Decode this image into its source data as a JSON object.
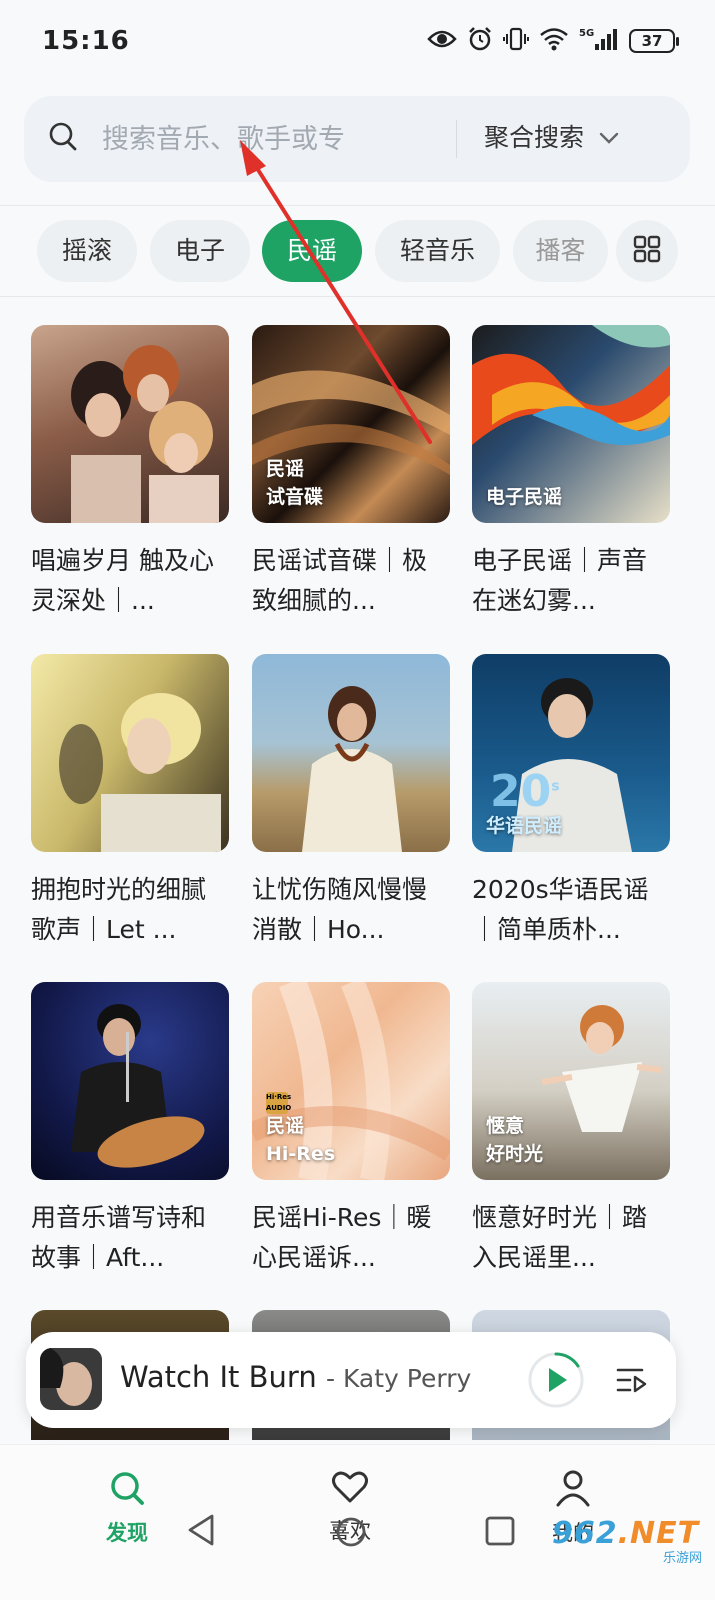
{
  "status_bar": {
    "time": "15:16",
    "battery": "37",
    "network": "5G"
  },
  "search": {
    "placeholder": "搜索音乐、歌手或专",
    "mode_label": "聚合搜索"
  },
  "tabs": [
    {
      "label": "摇滚",
      "active": false
    },
    {
      "label": "电子",
      "active": false
    },
    {
      "label": "民谣",
      "active": true
    },
    {
      "label": "轻音乐",
      "active": false
    },
    {
      "label": "播客",
      "active": false
    }
  ],
  "playlists": [
    {
      "title": "唱遍岁月 触及心灵深处｜...",
      "cover_label": []
    },
    {
      "title": "民谣试音碟｜极致细腻的...",
      "cover_label": [
        "民谣",
        "试音碟"
      ]
    },
    {
      "title": "电子民谣｜声音在迷幻雾...",
      "cover_label": [
        "电子民谣"
      ]
    },
    {
      "title": "拥抱时光的细腻歌声｜Let ...",
      "cover_label": []
    },
    {
      "title": "让忧伤随风慢慢消散｜Ho...",
      "cover_label": []
    },
    {
      "title": "2020s华语民谣｜简单质朴...",
      "cover_label": [
        "华语民谣"
      ],
      "cover_big": "20",
      "cover_small": "s"
    },
    {
      "title": "用音乐谱写诗和故事｜Aft...",
      "cover_label": []
    },
    {
      "title": "民谣Hi-Res｜暖心民谣诉...",
      "cover_label": [
        "民谣",
        "Hi-Res"
      ],
      "badge_top": "Hi·Res",
      "badge_bottom": "AUDIO"
    },
    {
      "title": "惬意好时光｜踏入民谣里...",
      "cover_label": [
        "惬意",
        "好时光"
      ]
    }
  ],
  "player": {
    "title": "Watch It Burn",
    "artist": "- Katy Perry"
  },
  "nav": [
    {
      "label": "发现",
      "active": true,
      "icon": "search-icon"
    },
    {
      "label": "喜欢",
      "active": false,
      "icon": "heart-icon"
    },
    {
      "label": "我的",
      "active": false,
      "icon": "person-icon"
    }
  ],
  "watermark": {
    "main_a": "962",
    "main_b": ".NET",
    "sub": "乐游网"
  }
}
